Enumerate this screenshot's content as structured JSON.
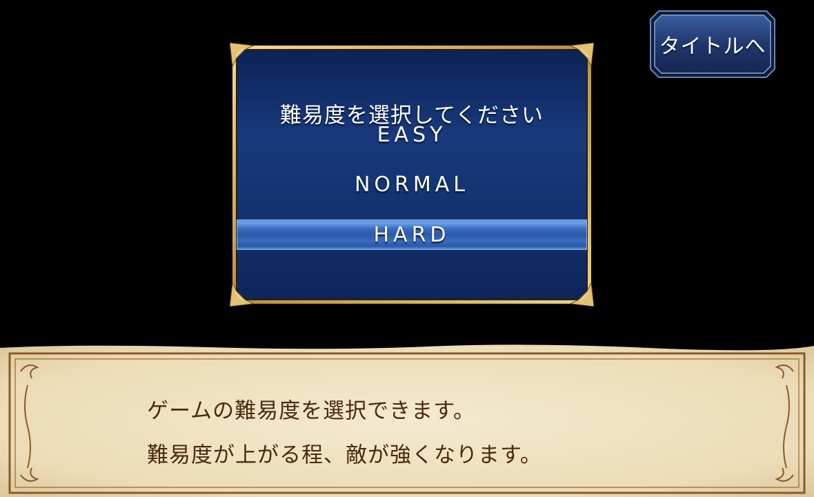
{
  "header": {
    "back_to_title_label": "タイトルへ"
  },
  "difficulty_menu": {
    "heading": "難易度を選択してください",
    "options": [
      {
        "label": "EASY",
        "selected": false
      },
      {
        "label": "NORMAL",
        "selected": false
      },
      {
        "label": "HARD",
        "selected": true
      }
    ]
  },
  "message_box": {
    "lines": [
      "ゲームの難易度を選択できます。",
      "難易度が上がる程、敵が強くなります。"
    ]
  },
  "colors": {
    "background": "#000000",
    "menu_panel": "#102a66",
    "menu_frame_gold": "#d9b865",
    "selected_highlight": "#3b6cc0",
    "parchment": "#efe3c4",
    "message_text": "#4a2a10"
  }
}
